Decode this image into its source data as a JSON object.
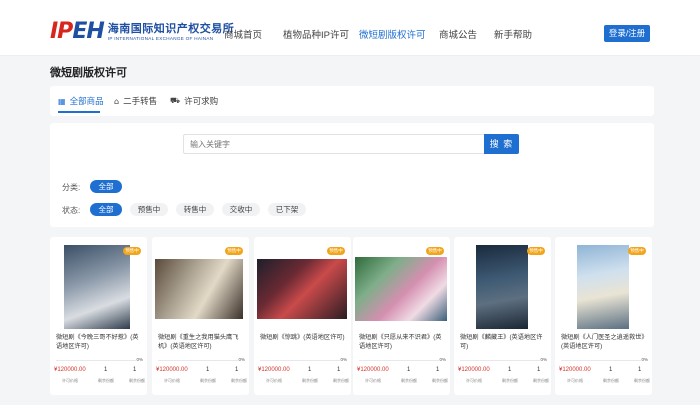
{
  "logo": {
    "mark_prefix": "IP",
    "mark_suffix": "EH",
    "name_cn": "海南国际知识产权交易所",
    "name_en": "IP INTERNATIONAL EXCHANGE OF HAINAN"
  },
  "nav": {
    "items": [
      "商城首页",
      "植物品种IP许可",
      "微短剧版权许可",
      "商城公告",
      "新手帮助"
    ],
    "active_index": 2
  },
  "header": {
    "login_label": "登录/注册"
  },
  "page": {
    "title": "微短剧版权许可"
  },
  "tabs": [
    {
      "label": "全部商品",
      "icon": "grid-icon",
      "glyph": "▦"
    },
    {
      "label": "二手转售",
      "icon": "home-icon",
      "glyph": "⌂"
    },
    {
      "label": "许可求购",
      "icon": "cart-icon",
      "glyph": "⛟"
    }
  ],
  "search": {
    "placeholder": "输入关键字",
    "button_label": "搜 索"
  },
  "filters": {
    "category_label": "分类:",
    "category_options": [
      "全部"
    ],
    "status_label": "状态:",
    "status_options": [
      "全部",
      "预售中",
      "转售中",
      "交收中",
      "已下架"
    ]
  },
  "colors": {
    "accent": "#1f6fd1",
    "price": "#d2332b",
    "badge": "#f2a51a"
  },
  "products": [
    {
      "badge": "预售中",
      "title": "微短剧《今晚三哥不好惹》(英语地区许可)",
      "progress_pct": "0%",
      "progress": 0,
      "price": "¥120000.00",
      "count_a": "1",
      "count_b": "1",
      "cap_price": "许可价格",
      "cap_a": "剩余份额",
      "cap_b": "剩余份额"
    },
    {
      "badge": "预售中",
      "title": "微短剧《重生之我用猫头鹰飞机》(英语地区许可)",
      "progress_pct": "0%",
      "progress": 0,
      "price": "¥120000.00",
      "count_a": "1",
      "count_b": "1",
      "cap_price": "许可价格",
      "cap_a": "剩余份额",
      "cap_b": "剩余份额"
    },
    {
      "badge": "预售中",
      "title": "微短剧《惊跳》(英语地区许可)",
      "progress_pct": "0%",
      "progress": 0,
      "price": "¥120000.00",
      "count_a": "1",
      "count_b": "1",
      "cap_price": "许可价格",
      "cap_a": "剩余份额",
      "cap_b": "剩余份额"
    },
    {
      "badge": "预售中",
      "title": "微短剧《只愿从来不识君》(英语地区许可)",
      "progress_pct": "0%",
      "progress": 0,
      "price": "¥120000.00",
      "count_a": "1",
      "count_b": "1",
      "cap_price": "许可价格",
      "cap_a": "剩余份额",
      "cap_b": "剩余份额"
    },
    {
      "badge": "预售中",
      "title": "微短剧《麟藏王》(英语地区许可)",
      "progress_pct": "0%",
      "progress": 0,
      "price": "¥120000.00",
      "count_a": "1",
      "count_b": "1",
      "cap_price": "许可价格",
      "cap_a": "剩余份额",
      "cap_b": "剩余份额"
    },
    {
      "badge": "预售中",
      "title": "微短剧《人门医圣之逍遥救世》(英语地区许可)",
      "progress_pct": "0%",
      "progress": 0,
      "price": "¥120000.00",
      "count_a": "1",
      "count_b": "1",
      "cap_price": "许可价格",
      "cap_a": "剩余份额",
      "cap_b": "剩余份额"
    }
  ]
}
